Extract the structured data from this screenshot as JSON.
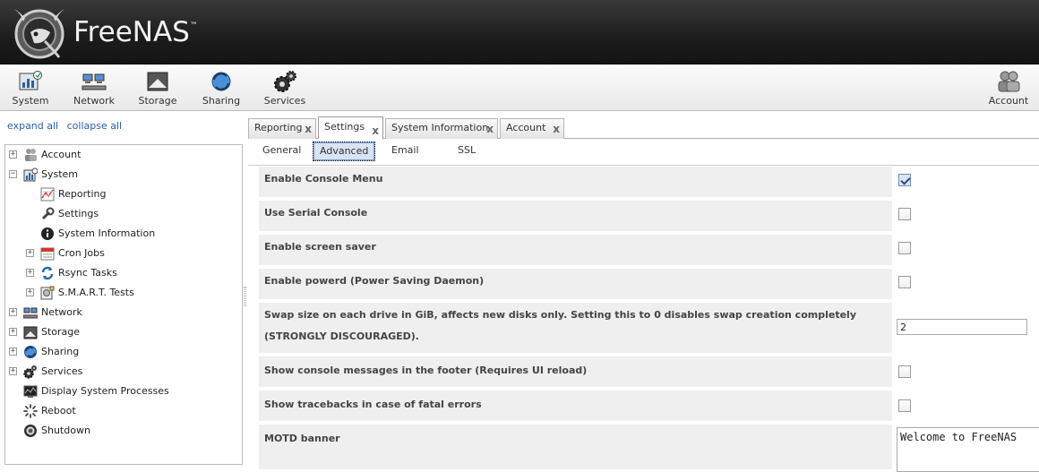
{
  "brand": {
    "name": "FreeNAS",
    "tm": "™"
  },
  "toolbar": {
    "items": [
      {
        "label": "System",
        "icon": "system-icon"
      },
      {
        "label": "Network",
        "icon": "network-icon"
      },
      {
        "label": "Storage",
        "icon": "storage-icon"
      },
      {
        "label": "Sharing",
        "icon": "sharing-icon"
      },
      {
        "label": "Services",
        "icon": "services-icon"
      }
    ],
    "account": {
      "label": "Account",
      "icon": "account-icon"
    }
  },
  "sidebar": {
    "expand_all": "expand all",
    "collapse_all": "collapse all",
    "tree": [
      {
        "label": "Account",
        "expander": "+",
        "icon": "account-icon"
      },
      {
        "label": "System",
        "expander": "−",
        "icon": "system-icon"
      },
      {
        "label": "Reporting",
        "expander": "",
        "icon": "reporting-icon"
      },
      {
        "label": "Settings",
        "expander": "",
        "icon": "wrench-icon"
      },
      {
        "label": "System Information",
        "expander": "",
        "icon": "info-icon"
      },
      {
        "label": "Cron Jobs",
        "expander": "+",
        "icon": "calendar-icon"
      },
      {
        "label": "Rsync Tasks",
        "expander": "+",
        "icon": "sync-icon"
      },
      {
        "label": "S.M.A.R.T. Tests",
        "expander": "+",
        "icon": "smart-icon"
      },
      {
        "label": "Network",
        "expander": "+",
        "icon": "network-icon"
      },
      {
        "label": "Storage",
        "expander": "+",
        "icon": "storage-icon"
      },
      {
        "label": "Sharing",
        "expander": "+",
        "icon": "sharing-icon"
      },
      {
        "label": "Services",
        "expander": "+",
        "icon": "services-icon"
      },
      {
        "label": "Display System Processes",
        "expander": "",
        "icon": "processes-icon"
      },
      {
        "label": "Reboot",
        "expander": "",
        "icon": "reboot-icon"
      },
      {
        "label": "Shutdown",
        "expander": "",
        "icon": "shutdown-icon"
      }
    ]
  },
  "tabs": [
    {
      "label": "Reporting",
      "close": "x"
    },
    {
      "label": "Settings",
      "close": "x",
      "active": true
    },
    {
      "label": "System Information",
      "close": "x"
    },
    {
      "label": "Account",
      "close": "x"
    }
  ],
  "subtabs": [
    {
      "label": "General"
    },
    {
      "label": "Advanced",
      "active": true
    },
    {
      "label": "Email"
    },
    {
      "label": "SSL"
    }
  ],
  "form": {
    "rows": [
      {
        "label": "Enable Console Menu",
        "type": "checkbox",
        "checked": true
      },
      {
        "label": "Use Serial Console",
        "type": "checkbox",
        "checked": false
      },
      {
        "label": "Enable screen saver",
        "type": "checkbox",
        "checked": false
      },
      {
        "label": "Enable powerd (Power Saving Daemon)",
        "type": "checkbox",
        "checked": false
      },
      {
        "label": "Swap size on each drive in GiB, affects new disks only. Setting this to 0 disables swap creation completely (STRONGLY DISCOURAGED).",
        "type": "text",
        "value": "2"
      },
      {
        "label": "Show console messages in the footer (Requires UI reload)",
        "type": "checkbox",
        "checked": false
      },
      {
        "label": "Show tracebacks in case of fatal errors",
        "type": "checkbox",
        "checked": false
      },
      {
        "label": "MOTD banner",
        "type": "textarea",
        "value": "Welcome to FreeNAS"
      }
    ]
  },
  "colors": {
    "header_bg": "#1c1c1c",
    "link": "#2a5db0",
    "row_bg": "#efefef"
  }
}
